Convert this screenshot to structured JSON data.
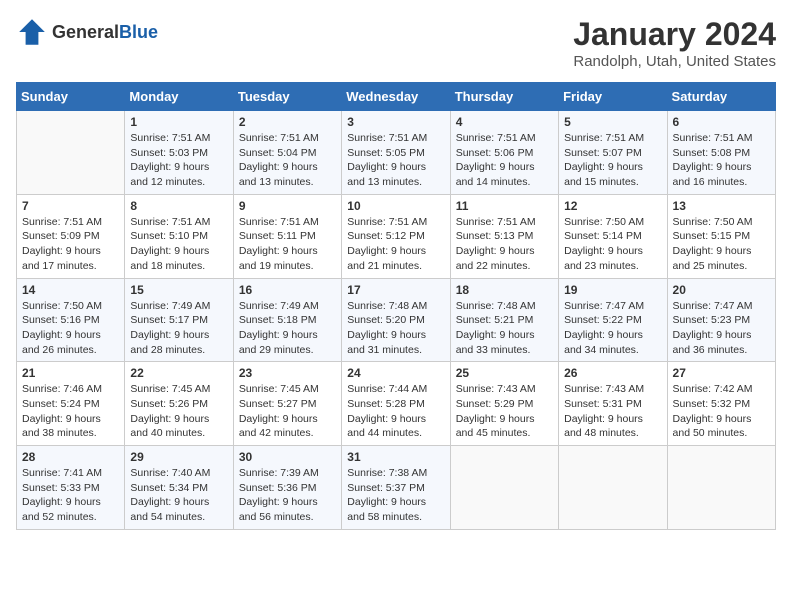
{
  "header": {
    "logo_general": "General",
    "logo_blue": "Blue",
    "title": "January 2024",
    "subtitle": "Randolph, Utah, United States"
  },
  "calendar": {
    "days_of_week": [
      "Sunday",
      "Monday",
      "Tuesday",
      "Wednesday",
      "Thursday",
      "Friday",
      "Saturday"
    ],
    "weeks": [
      [
        {
          "day": "",
          "info": ""
        },
        {
          "day": "1",
          "info": "Sunrise: 7:51 AM\nSunset: 5:03 PM\nDaylight: 9 hours and 12 minutes."
        },
        {
          "day": "2",
          "info": "Sunrise: 7:51 AM\nSunset: 5:04 PM\nDaylight: 9 hours and 13 minutes."
        },
        {
          "day": "3",
          "info": "Sunrise: 7:51 AM\nSunset: 5:05 PM\nDaylight: 9 hours and 13 minutes."
        },
        {
          "day": "4",
          "info": "Sunrise: 7:51 AM\nSunset: 5:06 PM\nDaylight: 9 hours and 14 minutes."
        },
        {
          "day": "5",
          "info": "Sunrise: 7:51 AM\nSunset: 5:07 PM\nDaylight: 9 hours and 15 minutes."
        },
        {
          "day": "6",
          "info": "Sunrise: 7:51 AM\nSunset: 5:08 PM\nDaylight: 9 hours and 16 minutes."
        }
      ],
      [
        {
          "day": "7",
          "info": "Sunrise: 7:51 AM\nSunset: 5:09 PM\nDaylight: 9 hours and 17 minutes."
        },
        {
          "day": "8",
          "info": "Sunrise: 7:51 AM\nSunset: 5:10 PM\nDaylight: 9 hours and 18 minutes."
        },
        {
          "day": "9",
          "info": "Sunrise: 7:51 AM\nSunset: 5:11 PM\nDaylight: 9 hours and 19 minutes."
        },
        {
          "day": "10",
          "info": "Sunrise: 7:51 AM\nSunset: 5:12 PM\nDaylight: 9 hours and 21 minutes."
        },
        {
          "day": "11",
          "info": "Sunrise: 7:51 AM\nSunset: 5:13 PM\nDaylight: 9 hours and 22 minutes."
        },
        {
          "day": "12",
          "info": "Sunrise: 7:50 AM\nSunset: 5:14 PM\nDaylight: 9 hours and 23 minutes."
        },
        {
          "day": "13",
          "info": "Sunrise: 7:50 AM\nSunset: 5:15 PM\nDaylight: 9 hours and 25 minutes."
        }
      ],
      [
        {
          "day": "14",
          "info": "Sunrise: 7:50 AM\nSunset: 5:16 PM\nDaylight: 9 hours and 26 minutes."
        },
        {
          "day": "15",
          "info": "Sunrise: 7:49 AM\nSunset: 5:17 PM\nDaylight: 9 hours and 28 minutes."
        },
        {
          "day": "16",
          "info": "Sunrise: 7:49 AM\nSunset: 5:18 PM\nDaylight: 9 hours and 29 minutes."
        },
        {
          "day": "17",
          "info": "Sunrise: 7:48 AM\nSunset: 5:20 PM\nDaylight: 9 hours and 31 minutes."
        },
        {
          "day": "18",
          "info": "Sunrise: 7:48 AM\nSunset: 5:21 PM\nDaylight: 9 hours and 33 minutes."
        },
        {
          "day": "19",
          "info": "Sunrise: 7:47 AM\nSunset: 5:22 PM\nDaylight: 9 hours and 34 minutes."
        },
        {
          "day": "20",
          "info": "Sunrise: 7:47 AM\nSunset: 5:23 PM\nDaylight: 9 hours and 36 minutes."
        }
      ],
      [
        {
          "day": "21",
          "info": "Sunrise: 7:46 AM\nSunset: 5:24 PM\nDaylight: 9 hours and 38 minutes."
        },
        {
          "day": "22",
          "info": "Sunrise: 7:45 AM\nSunset: 5:26 PM\nDaylight: 9 hours and 40 minutes."
        },
        {
          "day": "23",
          "info": "Sunrise: 7:45 AM\nSunset: 5:27 PM\nDaylight: 9 hours and 42 minutes."
        },
        {
          "day": "24",
          "info": "Sunrise: 7:44 AM\nSunset: 5:28 PM\nDaylight: 9 hours and 44 minutes."
        },
        {
          "day": "25",
          "info": "Sunrise: 7:43 AM\nSunset: 5:29 PM\nDaylight: 9 hours and 45 minutes."
        },
        {
          "day": "26",
          "info": "Sunrise: 7:43 AM\nSunset: 5:31 PM\nDaylight: 9 hours and 48 minutes."
        },
        {
          "day": "27",
          "info": "Sunrise: 7:42 AM\nSunset: 5:32 PM\nDaylight: 9 hours and 50 minutes."
        }
      ],
      [
        {
          "day": "28",
          "info": "Sunrise: 7:41 AM\nSunset: 5:33 PM\nDaylight: 9 hours and 52 minutes."
        },
        {
          "day": "29",
          "info": "Sunrise: 7:40 AM\nSunset: 5:34 PM\nDaylight: 9 hours and 54 minutes."
        },
        {
          "day": "30",
          "info": "Sunrise: 7:39 AM\nSunset: 5:36 PM\nDaylight: 9 hours and 56 minutes."
        },
        {
          "day": "31",
          "info": "Sunrise: 7:38 AM\nSunset: 5:37 PM\nDaylight: 9 hours and 58 minutes."
        },
        {
          "day": "",
          "info": ""
        },
        {
          "day": "",
          "info": ""
        },
        {
          "day": "",
          "info": ""
        }
      ]
    ]
  }
}
